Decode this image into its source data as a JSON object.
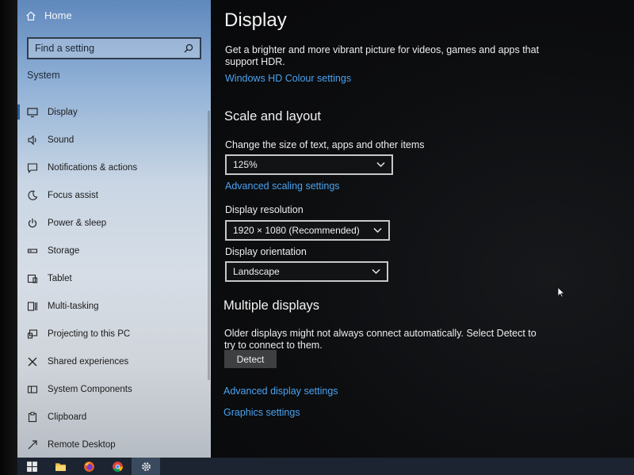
{
  "sidebar": {
    "home_label": "Home",
    "search_placeholder": "Find a setting",
    "section_title": "System",
    "items": [
      {
        "label": "Display",
        "icon": "monitor-icon"
      },
      {
        "label": "Sound",
        "icon": "speaker-icon"
      },
      {
        "label": "Notifications & actions",
        "icon": "message-icon"
      },
      {
        "label": "Focus assist",
        "icon": "moon-icon"
      },
      {
        "label": "Power & sleep",
        "icon": "power-icon"
      },
      {
        "label": "Storage",
        "icon": "storage-icon"
      },
      {
        "label": "Tablet",
        "icon": "tablet-icon"
      },
      {
        "label": "Multi-tasking",
        "icon": "multitask-icon"
      },
      {
        "label": "Projecting to this PC",
        "icon": "project-icon"
      },
      {
        "label": "Shared experiences",
        "icon": "share-icon"
      },
      {
        "label": "System Components",
        "icon": "components-icon"
      },
      {
        "label": "Clipboard",
        "icon": "clipboard-icon"
      },
      {
        "label": "Remote Desktop",
        "icon": "remote-desktop-icon"
      }
    ]
  },
  "main": {
    "title": "Display",
    "hdr_text_1": "Get a brighter and more vibrant picture for videos, games and apps that",
    "hdr_text_2": "support HDR.",
    "hdr_link": "Windows HD Colour settings",
    "scale_title": "Scale and layout",
    "scale_label": "Change the size of text, apps and other items",
    "scale_value": "125%",
    "advanced_scaling_link": "Advanced scaling settings",
    "resolution_label": "Display resolution",
    "resolution_value": "1920 × 1080 (Recommended)",
    "orientation_label": "Display orientation",
    "orientation_value": "Landscape",
    "multi_title": "Multiple displays",
    "multi_text_1": "Older displays might not always connect automatically. Select Detect to",
    "multi_text_2": "try to connect to them.",
    "detect_button": "Detect",
    "advanced_display_link": "Advanced display settings",
    "graphics_link": "Graphics settings"
  },
  "taskbar": {
    "items": [
      "windows-start-icon",
      "file-explorer-icon",
      "firefox-icon",
      "chrome-icon",
      "settings-gear-icon"
    ]
  },
  "colors": {
    "accent_link": "#4aa3f0",
    "background": "#0b0c0e"
  }
}
